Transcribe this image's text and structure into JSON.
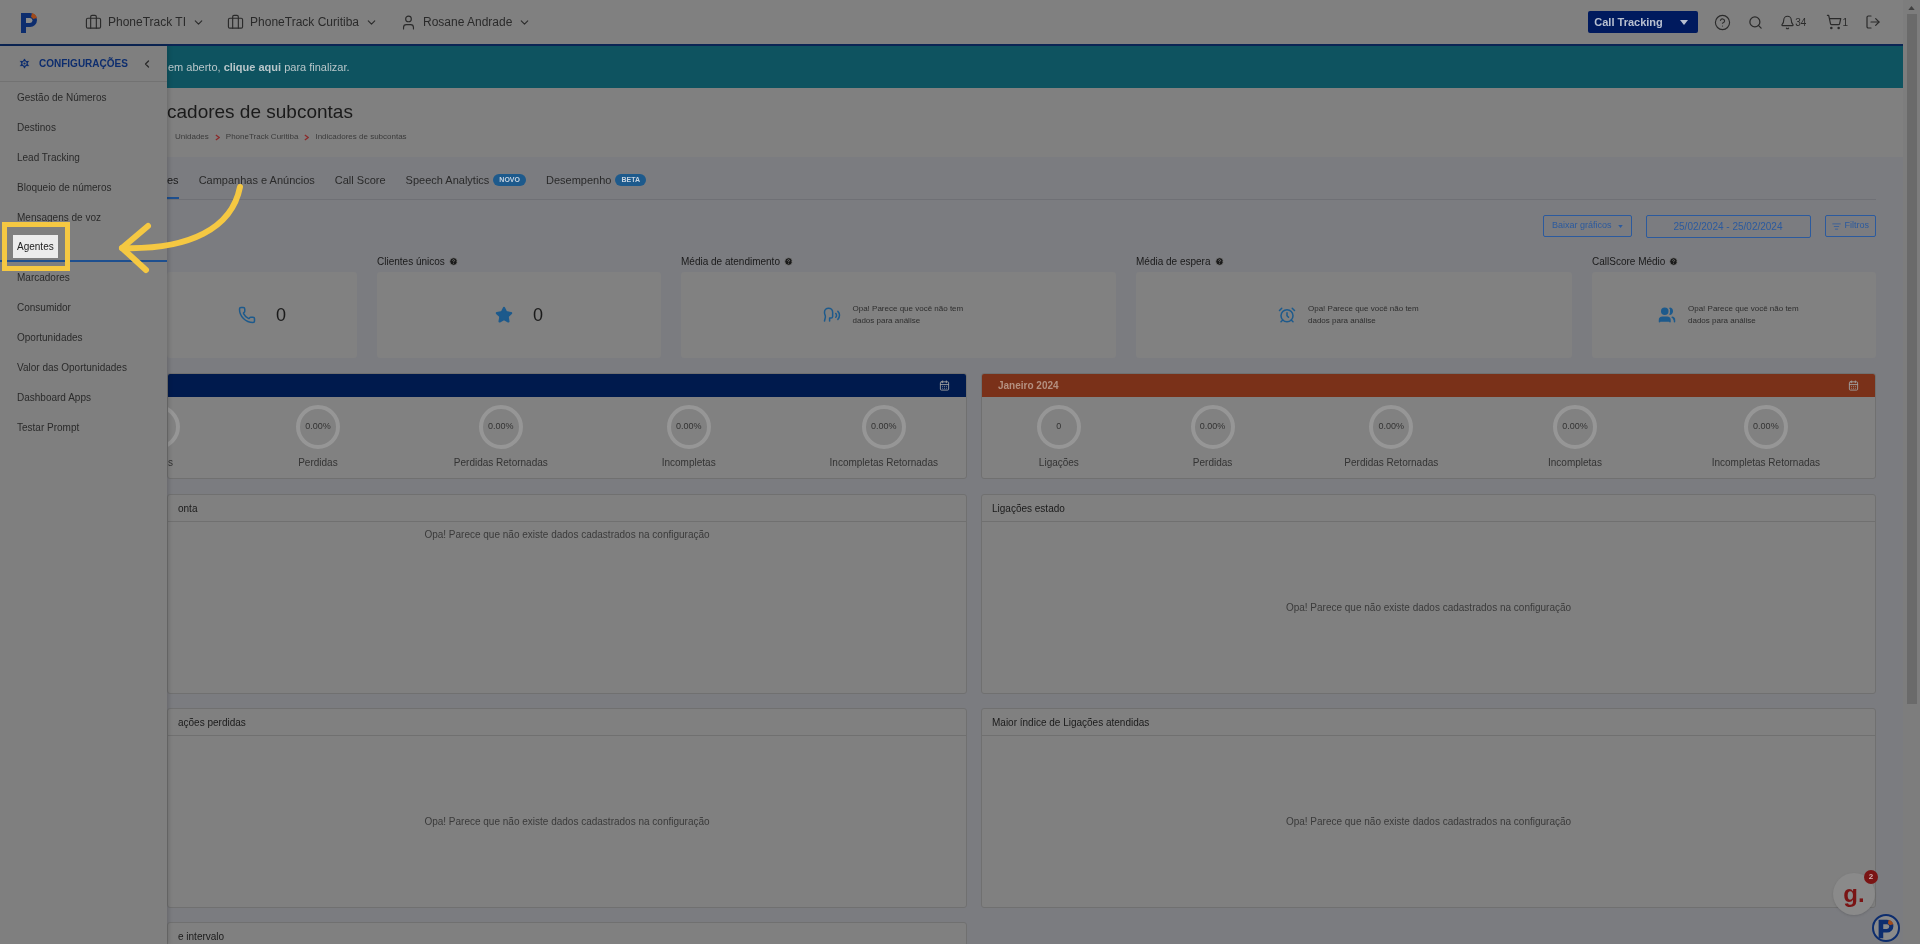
{
  "topbar": {
    "nav": [
      {
        "kind": "company",
        "label": "PhoneTrack TI"
      },
      {
        "kind": "company",
        "label": "PhoneTrack Curitiba"
      },
      {
        "kind": "user",
        "label": "Rosane Andrade"
      }
    ],
    "product_select": "Call Tracking",
    "notifications": "34",
    "cart": "1"
  },
  "banner": "em aberto, **clique aqui** para finalizar.",
  "sidebar": {
    "title": "CONFIGURAÇÕES",
    "items": [
      {
        "label": "Gestão de Números",
        "selected": false
      },
      {
        "label": "Destinos",
        "selected": false
      },
      {
        "label": "Lead Tracking",
        "selected": false
      },
      {
        "label": "Bloqueio de números",
        "selected": false
      },
      {
        "label": "Mensagens de voz",
        "selected": false
      },
      {
        "label": "Agentes",
        "selected": true
      },
      {
        "label": "Marcadores",
        "selected": false
      },
      {
        "label": "Consumidor",
        "selected": false
      },
      {
        "label": "Oportunidades",
        "selected": false
      },
      {
        "label": "Valor das Oportunidades",
        "selected": false
      },
      {
        "label": "Dashboard Apps",
        "selected": false
      },
      {
        "label": "Testar Prompt",
        "selected": false
      }
    ]
  },
  "page": {
    "title": "cadores de subcontas",
    "breadcrumb": [
      "Unidades",
      "PhoneTrack Curitiba",
      "Indicadores de subcontas"
    ]
  },
  "tabs": [
    {
      "label": "es",
      "selected": true
    },
    {
      "label": "Campanhas e Anúncios",
      "selected": false
    },
    {
      "label": "Call Score",
      "selected": false
    },
    {
      "label": "Speech Analytics",
      "badge": "NOVO",
      "selected": false
    },
    {
      "label": "Desempenho",
      "badge": "BETA",
      "selected": false
    }
  ],
  "toolbar": {
    "download": "Baixar gráficos",
    "date_range": "25/02/2024 - 25/02/2024",
    "filters": "Filtros"
  },
  "stats": [
    {
      "kind": "value",
      "value": "0"
    },
    {
      "kind": "value",
      "label": "Clientes únicos",
      "value": "0"
    },
    {
      "kind": "empty",
      "label": "Média de atendimento",
      "message": "Opa! Parece que você não tem dados para análise"
    },
    {
      "kind": "empty",
      "label": "Média de espera",
      "message": "Opa! Parece que você não tem dados para análise"
    },
    {
      "kind": "empty",
      "label": "CallScore Médio",
      "message": "Opa! Parece que você não tem dados para análise"
    }
  ],
  "months": [
    {
      "color": "#001a4d",
      "metrics": [
        {
          "label": "s"
        },
        {
          "value": "0.00%",
          "label": "Perdidas"
        },
        {
          "value": "0.00%",
          "label": "Perdidas Retornadas"
        },
        {
          "value": "0.00%",
          "label": "Incompletas"
        },
        {
          "value": "0.00%",
          "label": "Incompletas Retornadas"
        }
      ]
    },
    {
      "title": "Janeiro 2024",
      "color": "#7a3119",
      "metrics": [
        {
          "value": "0",
          "label": "Ligações"
        },
        {
          "value": "0.00%",
          "label": "Perdidas"
        },
        {
          "value": "0.00%",
          "label": "Perdidas Retornadas"
        },
        {
          "value": "0.00%",
          "label": "Incompletas"
        },
        {
          "value": "0.00%",
          "label": "Incompletas Retornadas"
        }
      ]
    }
  ],
  "panels": [
    {
      "title": "onta",
      "message": "Opa! Parece que não existe dados cadastrados na configuração",
      "kind": "top"
    },
    {
      "title": "Ligações estado",
      "message": "Opa! Parece que não existe dados cadastrados na configuração",
      "kind": "center"
    },
    {
      "title": "ações perdidas",
      "message": "Opa! Parece que não existe dados cadastrados na configuração",
      "kind": "center"
    },
    {
      "title": "Maior índice de Ligações atendidas",
      "message": "Opa! Parece que não existe dados cadastrados na configuração",
      "kind": "center"
    },
    {
      "title": "e intervalo"
    }
  ],
  "chat_widget": {
    "logo": "g.",
    "badge": "2"
  }
}
